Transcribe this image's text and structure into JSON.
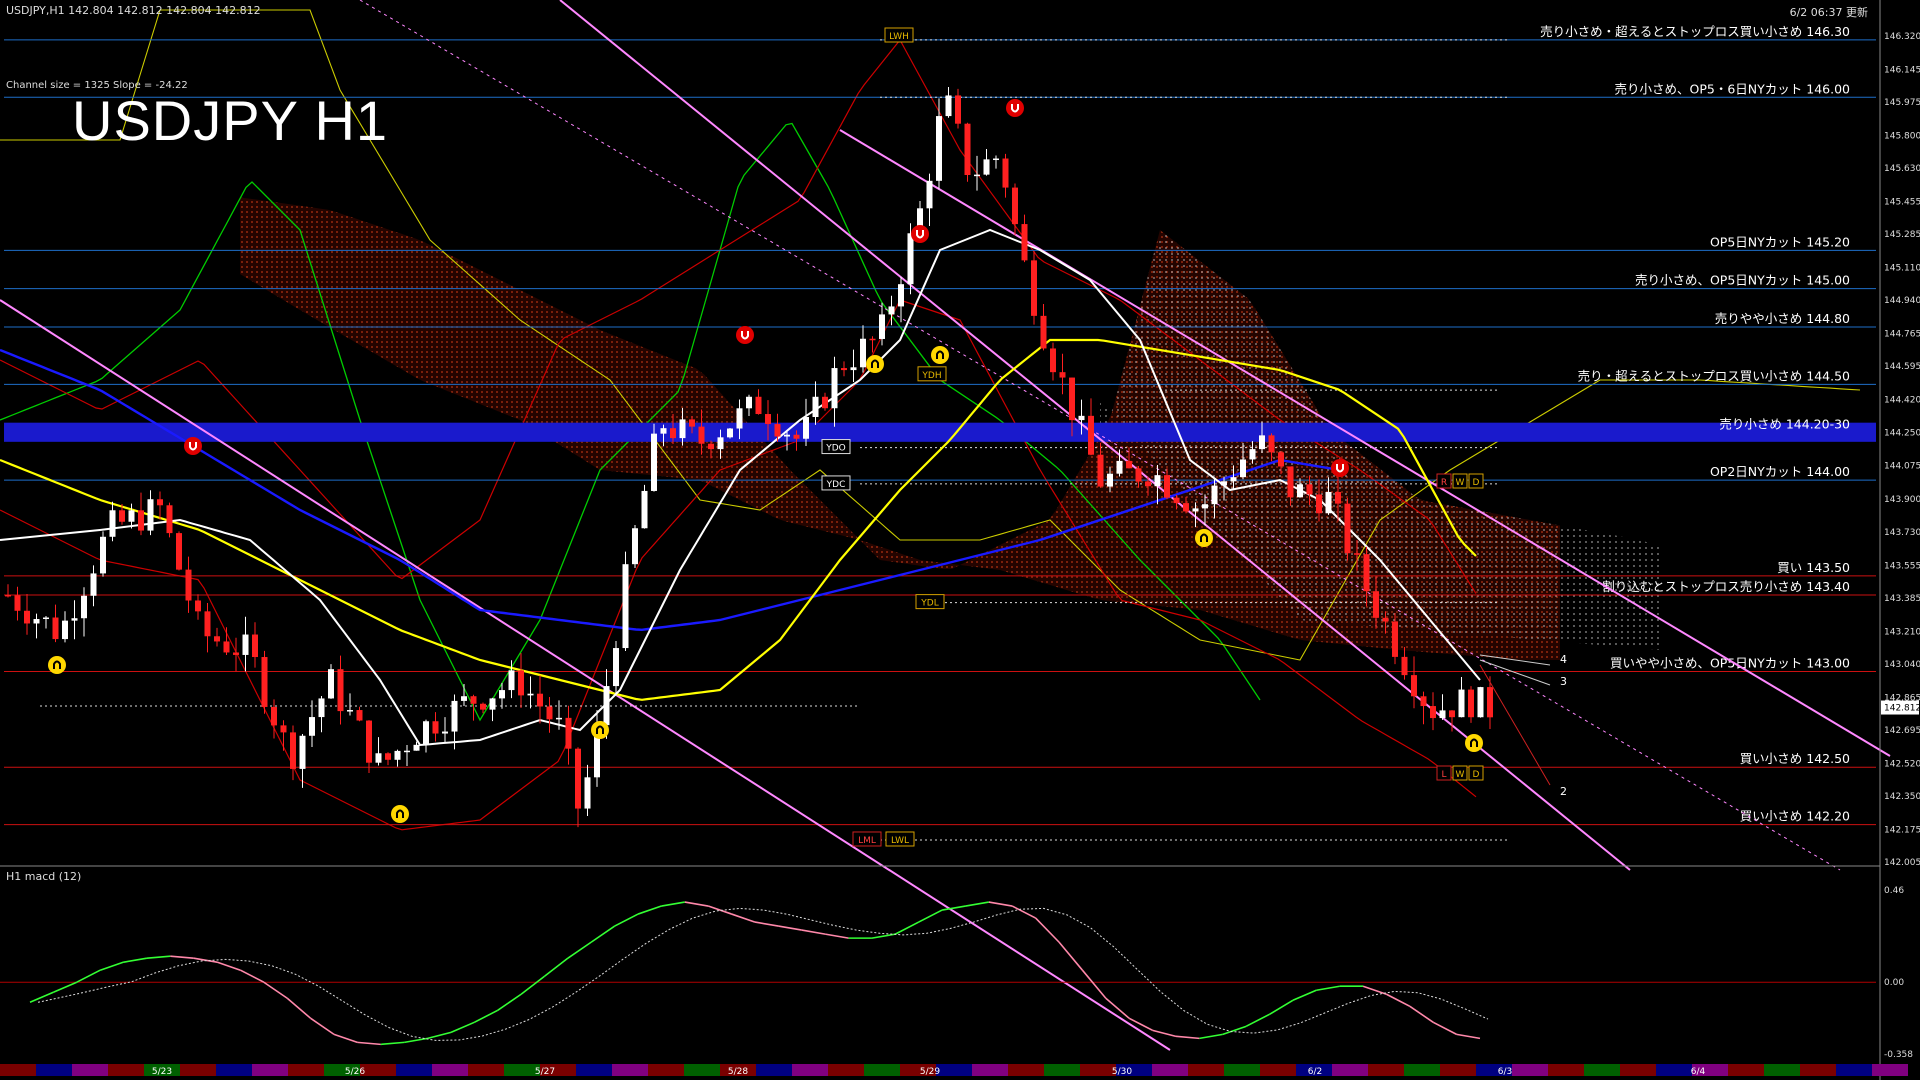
{
  "header": {
    "symbol_info": "USDJPY,H1 142.804 142.812 142.804 142.812",
    "timestamp": "6/2 06:37 更新",
    "channel_info": "Channel size = 1325 Slope = -24.22"
  },
  "title": "USDJPY H1",
  "macd_label": "H1 macd (12)",
  "colors": {
    "background": "#000000",
    "bull_candle": "#ffffff",
    "bear_candle": "#ff2020",
    "ma_white": "#ffffff",
    "ma_yellow": "#ffff00",
    "ma_blue": "#1a1aff",
    "bollinger": "#cc0000",
    "ichimoku_green": "#00cc00",
    "ichimoku_cloud": "#aa2200",
    "channel": "#ff88ff",
    "level_line": "#1e6ec8",
    "resistance_band": "#1a1acc",
    "macd_up": "#33ff33",
    "macd_down": "#ff88aa"
  },
  "chart_data": {
    "type": "line",
    "symbol": "USDJPY",
    "timeframe": "H1",
    "ylim": [
      142.005,
      146.32
    ],
    "y_ticks": [
      "146.320",
      "146.145",
      "145.975",
      "145.800",
      "145.630",
      "145.455",
      "145.285",
      "145.110",
      "144.940",
      "144.765",
      "144.595",
      "144.420",
      "144.250",
      "144.075",
      "143.900",
      "143.730",
      "143.555",
      "143.385",
      "143.210",
      "143.040",
      "142.865",
      "142.695",
      "142.520",
      "142.350",
      "142.175",
      "142.005"
    ],
    "current_price": "142.812",
    "x_labels": [
      "5/23",
      "5/26",
      "5/27",
      "5/28",
      "5/29",
      "5/30",
      "6/2",
      "6/3",
      "6/4"
    ],
    "levels": [
      {
        "price": 146.3,
        "label": "売り小さめ・超えるとストップロス買い小さめ 146.30",
        "color": "#1e6ec8"
      },
      {
        "price": 146.0,
        "label": "売り小さめ、OP5・6日NYカット 146.00",
        "color": "#1e6ec8"
      },
      {
        "price": 145.2,
        "label": "OP5日NYカット 145.20",
        "color": "#1e6ec8"
      },
      {
        "price": 145.0,
        "label": "売り小さめ、OP5日NYカット 145.00",
        "color": "#1e6ec8"
      },
      {
        "price": 144.8,
        "label": "売りやや小さめ 144.80",
        "color": "#1e6ec8"
      },
      {
        "price": 144.5,
        "label": "売り・超えるとストップロス買い小さめ 144.50",
        "color": "#1e6ec8"
      },
      {
        "price": 144.25,
        "label": "売り小さめ 144.20-30",
        "color": "#1a1acc"
      },
      {
        "price": 144.0,
        "label": "OP2日NYカット 144.00",
        "color": "#1e6ec8"
      },
      {
        "price": 143.5,
        "label": "買い 143.50",
        "color": "#cc1010"
      },
      {
        "price": 143.4,
        "label": "割り込むとストップロス売り小さめ 143.40",
        "color": "#cc1010"
      },
      {
        "price": 143.0,
        "label": "買いやや小さめ、OP5日NYカット 143.00",
        "color": "#cc1010"
      },
      {
        "price": 142.5,
        "label": "買い小さめ 142.50",
        "color": "#cc1010"
      },
      {
        "price": 142.2,
        "label": "買い小さめ 142.20",
        "color": "#cc1010"
      }
    ],
    "tags": [
      {
        "text": "LWH",
        "price": 146.32
      },
      {
        "text": "YDH",
        "price": 144.55
      },
      {
        "text": "YDO",
        "price": 144.17
      },
      {
        "text": "YDC",
        "price": 143.98
      },
      {
        "text": "YDL",
        "price": 143.36
      },
      {
        "text": "LWL",
        "price": 142.12
      },
      {
        "text": "LML",
        "price": 142.12
      }
    ],
    "projection_labels": [
      "4",
      "3",
      "2"
    ],
    "macd": {
      "name": "macd (12)",
      "y_ticks": [
        "0.46",
        "0.00",
        "-0.358"
      ],
      "ylim": [
        -0.358,
        0.46
      ],
      "values": [
        -0.1,
        -0.05,
        0.0,
        0.06,
        0.1,
        0.12,
        0.13,
        0.12,
        0.1,
        0.06,
        0.0,
        -0.08,
        -0.18,
        -0.26,
        -0.3,
        -0.31,
        -0.3,
        -0.28,
        -0.25,
        -0.2,
        -0.14,
        -0.06,
        0.03,
        0.12,
        0.2,
        0.28,
        0.34,
        0.38,
        0.4,
        0.38,
        0.34,
        0.3,
        0.28,
        0.26,
        0.24,
        0.22,
        0.22,
        0.24,
        0.3,
        0.36,
        0.38,
        0.4,
        0.38,
        0.32,
        0.2,
        0.06,
        -0.08,
        -0.18,
        -0.24,
        -0.27,
        -0.28,
        -0.26,
        -0.22,
        -0.16,
        -0.09,
        -0.04,
        -0.02,
        -0.02,
        -0.06,
        -0.12,
        -0.2,
        -0.26,
        -0.28
      ]
    }
  }
}
